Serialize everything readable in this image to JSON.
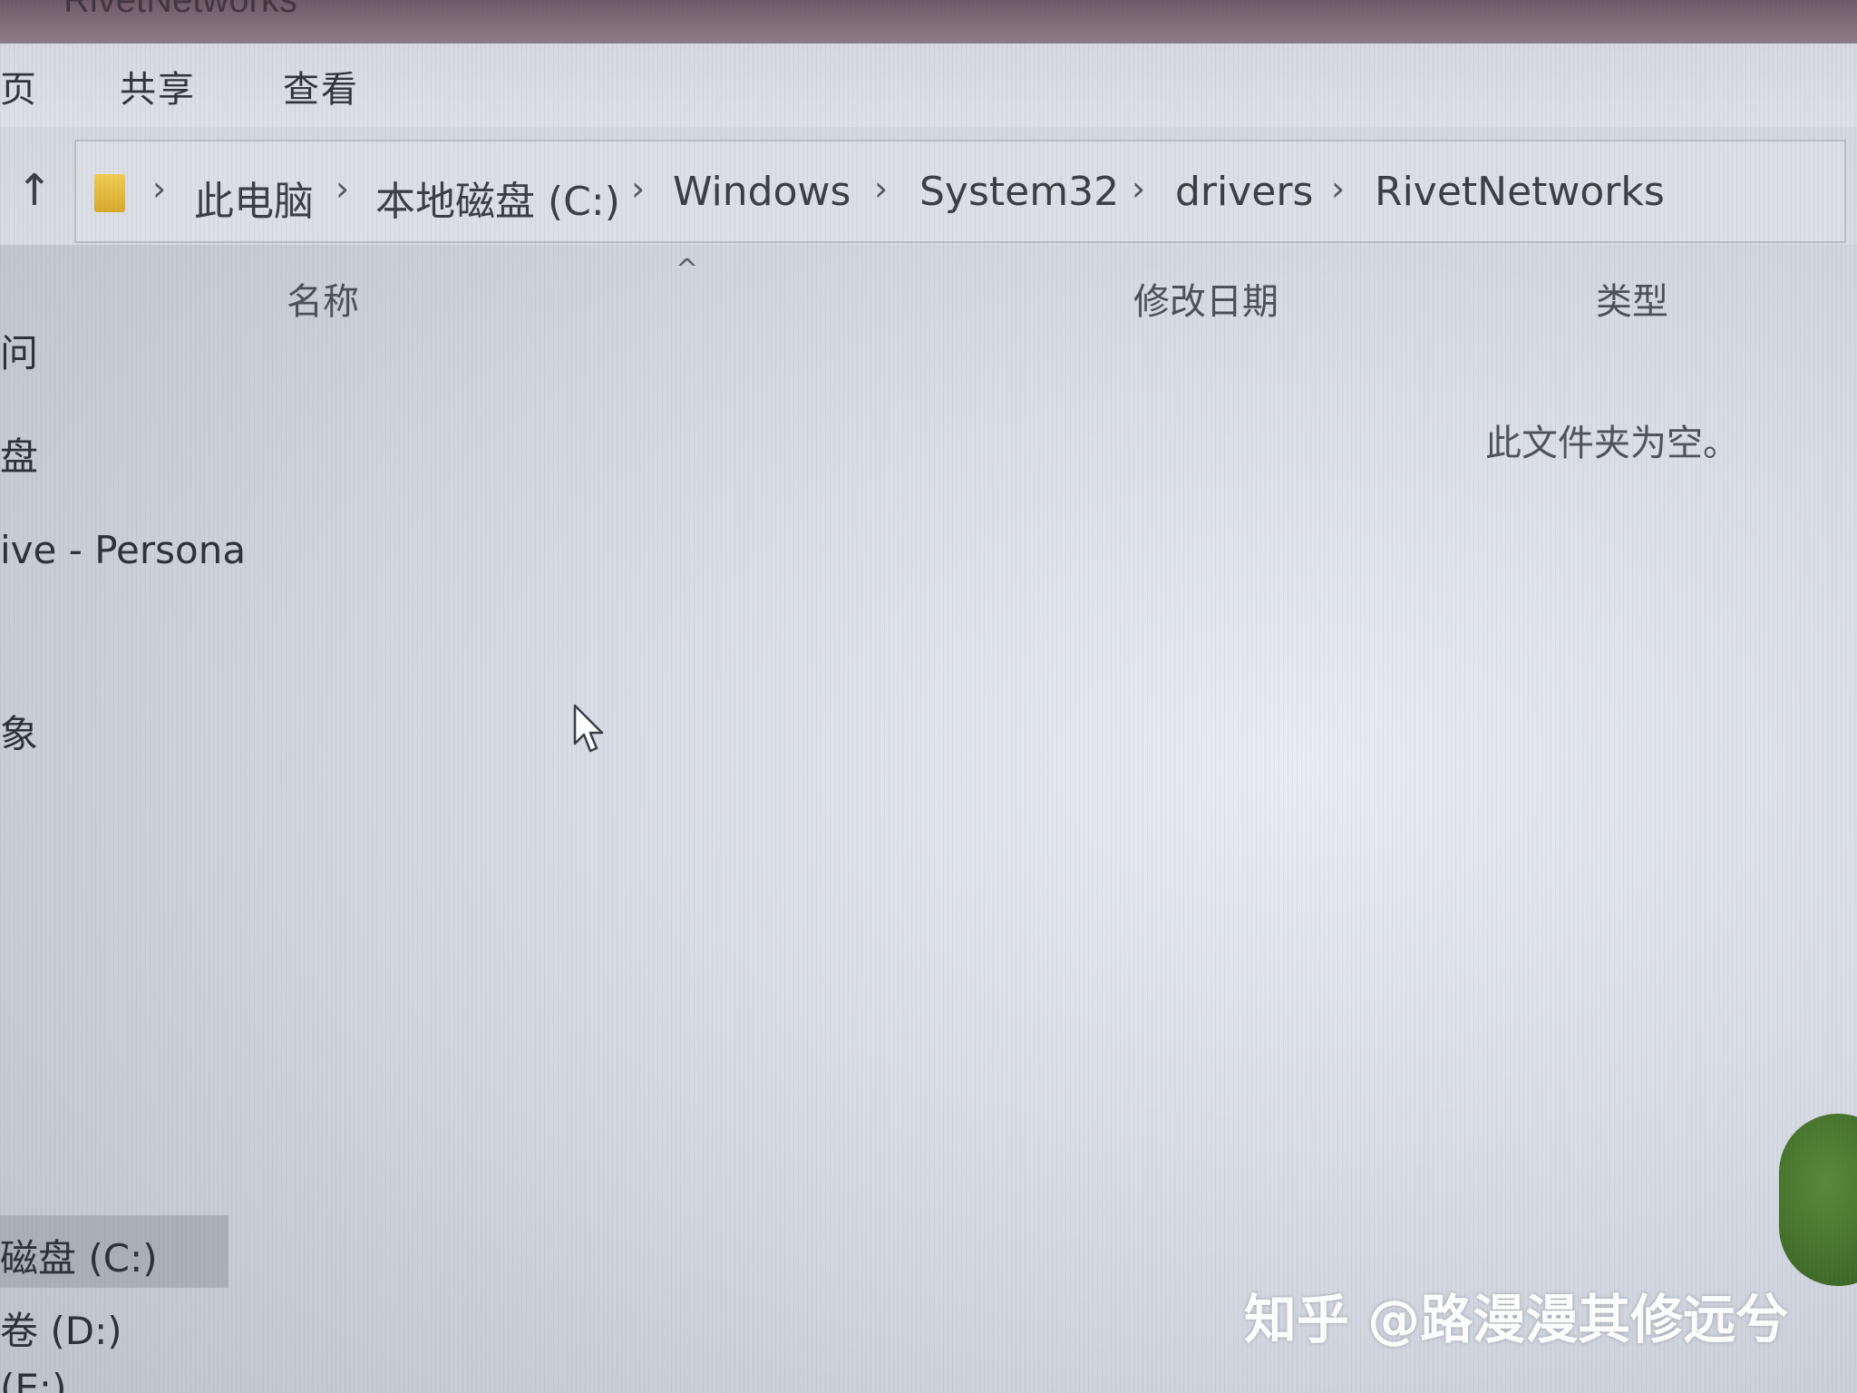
{
  "window": {
    "title": "RivetNetworks"
  },
  "ribbon": {
    "tabs": [
      "页",
      "共享",
      "查看"
    ]
  },
  "address": {
    "up_icon": "arrow-up-icon",
    "folder_icon": "folder-icon",
    "crumbs": [
      "此电脑",
      "本地磁盘 (C:)",
      "Windows",
      "System32",
      "drivers",
      "RivetNetworks"
    ],
    "separator": "›"
  },
  "columns": {
    "sort_indicator": "^",
    "name": "名称",
    "modified": "修改日期",
    "type": "类型"
  },
  "content": {
    "empty_message": "此文件夹为空。"
  },
  "navigation": {
    "items": [
      "问",
      "盘",
      "ive - Persona",
      "象",
      "磁盘 (C:)",
      "卷 (D:)",
      "(E:)"
    ],
    "selected_index": 4
  },
  "watermark": {
    "text": "知乎 @路漫漫其修远兮"
  },
  "colors": {
    "folder": "#e4b93c",
    "selection": "#aab0b9",
    "float_button": "#4a7a2f"
  }
}
